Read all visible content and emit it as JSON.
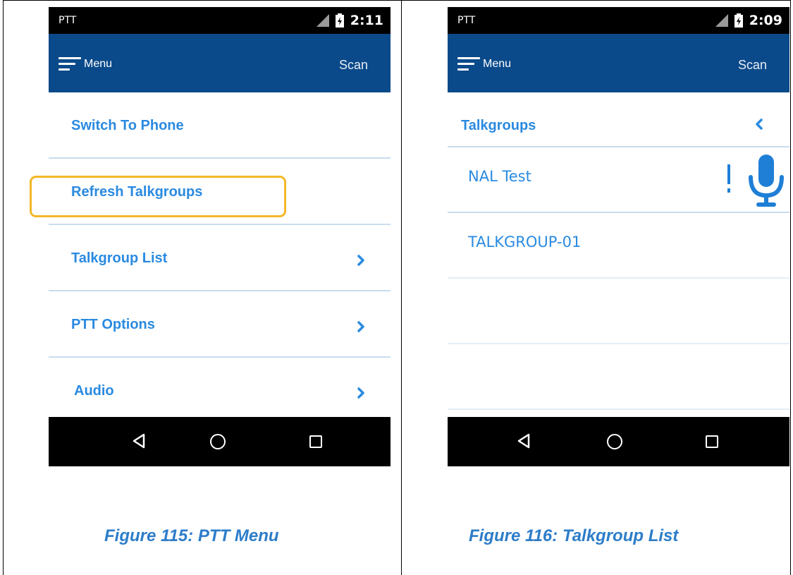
{
  "left_phone": {
    "status": {
      "app": "PTT",
      "time": "2:11"
    },
    "appbar": {
      "menu_label": "Menu",
      "scan_label": "Scan"
    },
    "items": [
      {
        "label": "Switch To Phone",
        "has_chevron": false
      },
      {
        "label": "Refresh Talkgroups",
        "has_chevron": false,
        "highlighted": true
      },
      {
        "label": "Talkgroup List",
        "has_chevron": true
      },
      {
        "label": "PTT Options",
        "has_chevron": true
      },
      {
        "label": "Audio",
        "has_chevron": true
      }
    ],
    "caption": "Figure 115: PTT Menu"
  },
  "right_phone": {
    "status": {
      "app": "PTT",
      "time": "2:09"
    },
    "appbar": {
      "menu_label": "Menu",
      "scan_label": "Scan"
    },
    "header": {
      "title": "Talkgroups"
    },
    "talkgroups": [
      {
        "label": "NAL Test"
      },
      {
        "label": "TALKGROUP-01"
      }
    ],
    "caption": "Figure 116: Talkgroup List"
  },
  "colors": {
    "appbar": "#0b4a8a",
    "accent_text": "#2a8ae0",
    "highlight_border": "#f4b726",
    "caption": "#2d7dc9",
    "mic": "#1f7fd6"
  }
}
